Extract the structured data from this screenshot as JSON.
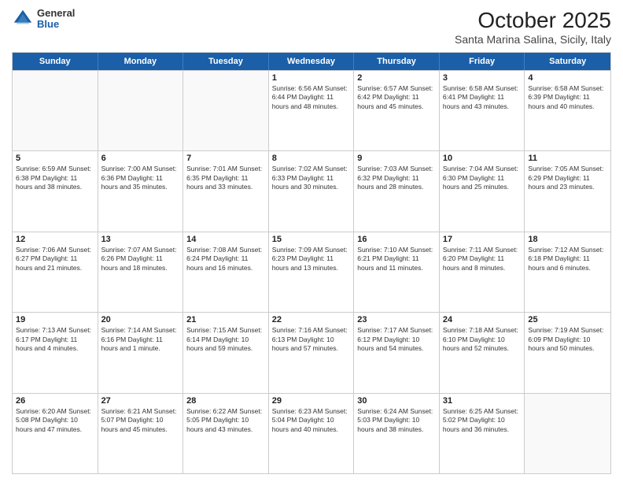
{
  "header": {
    "logo": {
      "general": "General",
      "blue": "Blue"
    },
    "title": "October 2025",
    "location": "Santa Marina Salina, Sicily, Italy"
  },
  "days_of_week": [
    "Sunday",
    "Monday",
    "Tuesday",
    "Wednesday",
    "Thursday",
    "Friday",
    "Saturday"
  ],
  "weeks": [
    [
      {
        "day": "",
        "text": ""
      },
      {
        "day": "",
        "text": ""
      },
      {
        "day": "",
        "text": ""
      },
      {
        "day": "1",
        "text": "Sunrise: 6:56 AM\nSunset: 6:44 PM\nDaylight: 11 hours and 48 minutes."
      },
      {
        "day": "2",
        "text": "Sunrise: 6:57 AM\nSunset: 6:42 PM\nDaylight: 11 hours and 45 minutes."
      },
      {
        "day": "3",
        "text": "Sunrise: 6:58 AM\nSunset: 6:41 PM\nDaylight: 11 hours and 43 minutes."
      },
      {
        "day": "4",
        "text": "Sunrise: 6:58 AM\nSunset: 6:39 PM\nDaylight: 11 hours and 40 minutes."
      }
    ],
    [
      {
        "day": "5",
        "text": "Sunrise: 6:59 AM\nSunset: 6:38 PM\nDaylight: 11 hours and 38 minutes."
      },
      {
        "day": "6",
        "text": "Sunrise: 7:00 AM\nSunset: 6:36 PM\nDaylight: 11 hours and 35 minutes."
      },
      {
        "day": "7",
        "text": "Sunrise: 7:01 AM\nSunset: 6:35 PM\nDaylight: 11 hours and 33 minutes."
      },
      {
        "day": "8",
        "text": "Sunrise: 7:02 AM\nSunset: 6:33 PM\nDaylight: 11 hours and 30 minutes."
      },
      {
        "day": "9",
        "text": "Sunrise: 7:03 AM\nSunset: 6:32 PM\nDaylight: 11 hours and 28 minutes."
      },
      {
        "day": "10",
        "text": "Sunrise: 7:04 AM\nSunset: 6:30 PM\nDaylight: 11 hours and 25 minutes."
      },
      {
        "day": "11",
        "text": "Sunrise: 7:05 AM\nSunset: 6:29 PM\nDaylight: 11 hours and 23 minutes."
      }
    ],
    [
      {
        "day": "12",
        "text": "Sunrise: 7:06 AM\nSunset: 6:27 PM\nDaylight: 11 hours and 21 minutes."
      },
      {
        "day": "13",
        "text": "Sunrise: 7:07 AM\nSunset: 6:26 PM\nDaylight: 11 hours and 18 minutes."
      },
      {
        "day": "14",
        "text": "Sunrise: 7:08 AM\nSunset: 6:24 PM\nDaylight: 11 hours and 16 minutes."
      },
      {
        "day": "15",
        "text": "Sunrise: 7:09 AM\nSunset: 6:23 PM\nDaylight: 11 hours and 13 minutes."
      },
      {
        "day": "16",
        "text": "Sunrise: 7:10 AM\nSunset: 6:21 PM\nDaylight: 11 hours and 11 minutes."
      },
      {
        "day": "17",
        "text": "Sunrise: 7:11 AM\nSunset: 6:20 PM\nDaylight: 11 hours and 8 minutes."
      },
      {
        "day": "18",
        "text": "Sunrise: 7:12 AM\nSunset: 6:18 PM\nDaylight: 11 hours and 6 minutes."
      }
    ],
    [
      {
        "day": "19",
        "text": "Sunrise: 7:13 AM\nSunset: 6:17 PM\nDaylight: 11 hours and 4 minutes."
      },
      {
        "day": "20",
        "text": "Sunrise: 7:14 AM\nSunset: 6:16 PM\nDaylight: 11 hours and 1 minute."
      },
      {
        "day": "21",
        "text": "Sunrise: 7:15 AM\nSunset: 6:14 PM\nDaylight: 10 hours and 59 minutes."
      },
      {
        "day": "22",
        "text": "Sunrise: 7:16 AM\nSunset: 6:13 PM\nDaylight: 10 hours and 57 minutes."
      },
      {
        "day": "23",
        "text": "Sunrise: 7:17 AM\nSunset: 6:12 PM\nDaylight: 10 hours and 54 minutes."
      },
      {
        "day": "24",
        "text": "Sunrise: 7:18 AM\nSunset: 6:10 PM\nDaylight: 10 hours and 52 minutes."
      },
      {
        "day": "25",
        "text": "Sunrise: 7:19 AM\nSunset: 6:09 PM\nDaylight: 10 hours and 50 minutes."
      }
    ],
    [
      {
        "day": "26",
        "text": "Sunrise: 6:20 AM\nSunset: 5:08 PM\nDaylight: 10 hours and 47 minutes."
      },
      {
        "day": "27",
        "text": "Sunrise: 6:21 AM\nSunset: 5:07 PM\nDaylight: 10 hours and 45 minutes."
      },
      {
        "day": "28",
        "text": "Sunrise: 6:22 AM\nSunset: 5:05 PM\nDaylight: 10 hours and 43 minutes."
      },
      {
        "day": "29",
        "text": "Sunrise: 6:23 AM\nSunset: 5:04 PM\nDaylight: 10 hours and 40 minutes."
      },
      {
        "day": "30",
        "text": "Sunrise: 6:24 AM\nSunset: 5:03 PM\nDaylight: 10 hours and 38 minutes."
      },
      {
        "day": "31",
        "text": "Sunrise: 6:25 AM\nSunset: 5:02 PM\nDaylight: 10 hours and 36 minutes."
      },
      {
        "day": "",
        "text": ""
      }
    ]
  ]
}
